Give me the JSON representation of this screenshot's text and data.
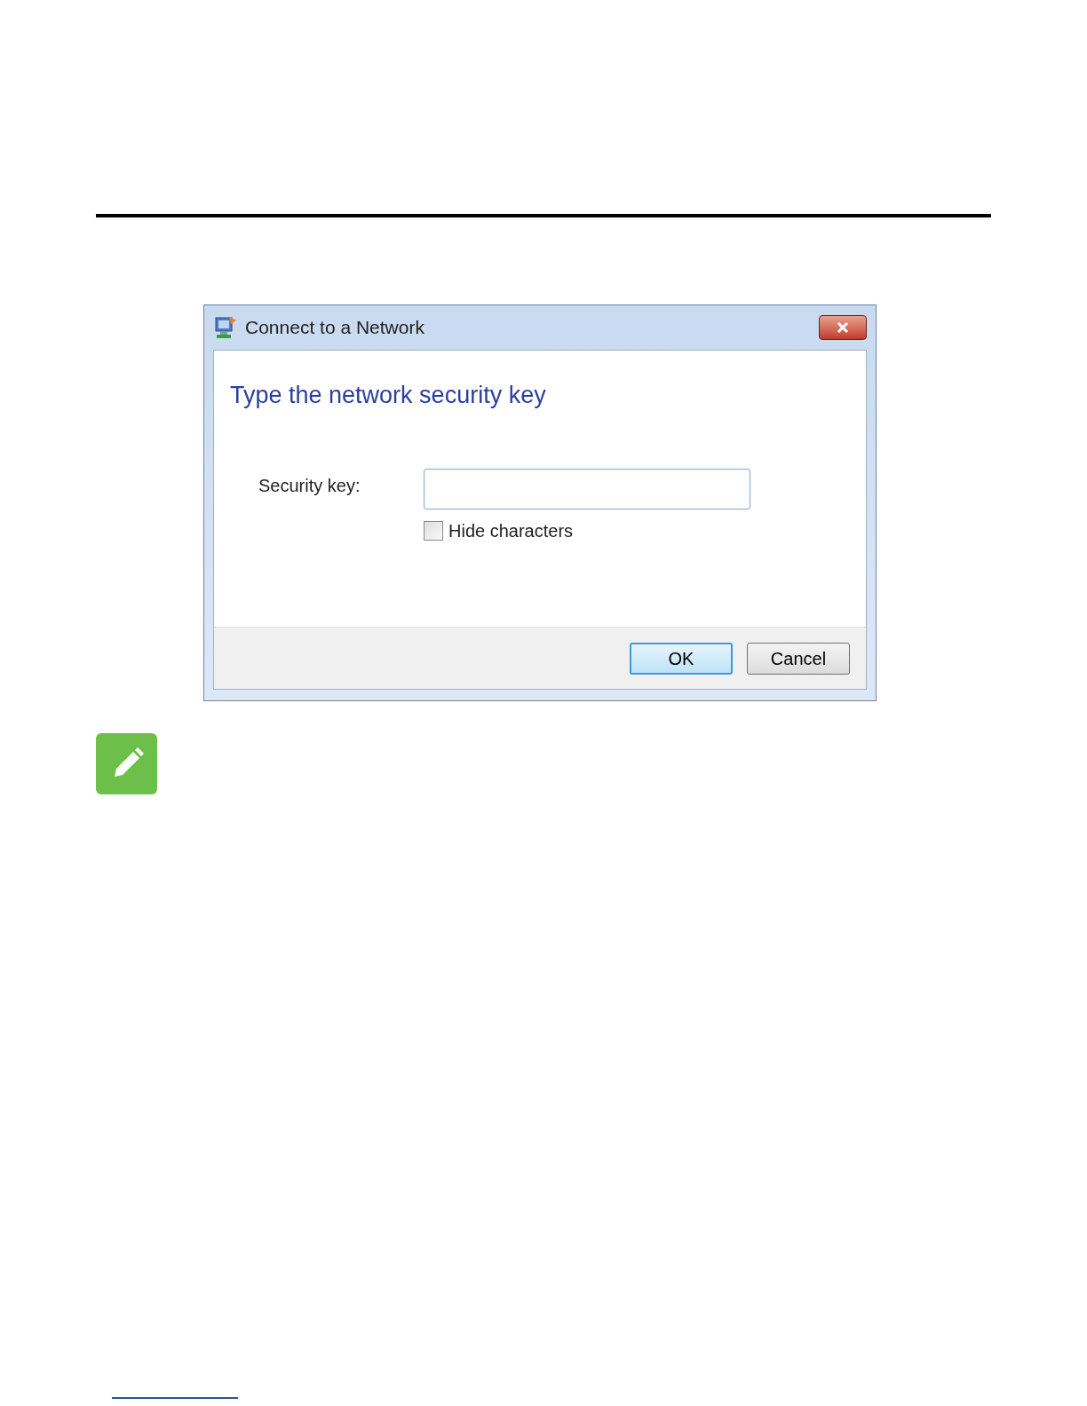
{
  "window": {
    "title": "Connect to a Network"
  },
  "heading": "Type the network security key",
  "security_key": {
    "label": "Security key:"
  },
  "hide_characters": {
    "label": "Hide characters",
    "checked": false
  },
  "buttons": [
    {
      "label": "OK",
      "default": true
    },
    {
      "label": "Cancel",
      "default": false
    }
  ]
}
